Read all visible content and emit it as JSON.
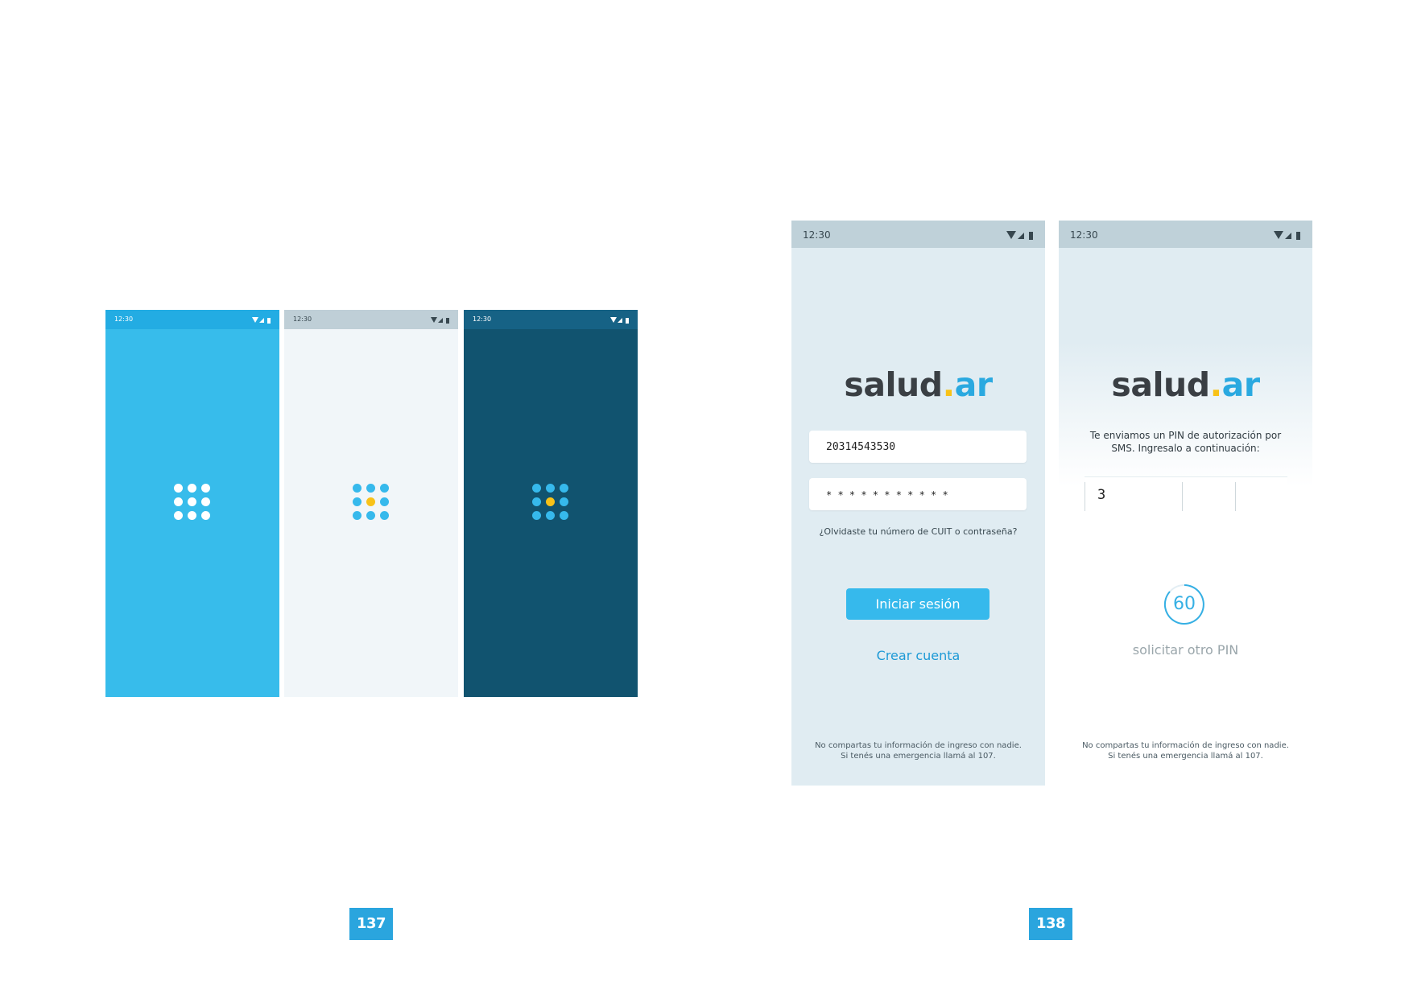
{
  "status_bar": {
    "time": "12:30"
  },
  "splash_screens": [
    {
      "theme": "light-blue",
      "bg": "#37bceb",
      "bar": "#23ace3",
      "dot": "#ffffff",
      "center_dot": "#ffffff"
    },
    {
      "theme": "white",
      "bg": "#f1f6f9",
      "bar": "#bfcfd7",
      "dot": "#36b9ec",
      "center_dot": "#f8c218"
    },
    {
      "theme": "dark-blue",
      "bg": "#11536f",
      "bar": "#166285",
      "dot": "#36b9ec",
      "center_dot": "#f8c218"
    }
  ],
  "logo": {
    "part1": "salud",
    "dot": ".",
    "part2": "ar"
  },
  "login": {
    "cuit_value": "20314543530",
    "password_value": "* * * * * * * * * * *",
    "forgot_link": "¿Olvidaste tu número de CUIT o contraseña?",
    "login_button": "Iniciar sesión",
    "create_account_link": "Crear cuenta",
    "footer_line1": "No compartas tu información de ingreso con nadie.",
    "footer_line2": "Si tenés una emergencia llamá al 107."
  },
  "pin": {
    "message_line1": "Te enviamos un PIN de autorización por",
    "message_line2": "SMS. Ingresalo a continuación:",
    "pin_value": "3",
    "countdown": "60",
    "resend_link": "solicitar otro PIN",
    "footer_line1": "No compartas tu información de ingreso con nadie.",
    "footer_line2": "Si tenés una emergencia llamá al 107."
  },
  "page_numbers": {
    "left": "137",
    "right": "138"
  },
  "colors": {
    "accent": "#36b9ec",
    "yellow": "#f8c218",
    "page_badge": "#2aa5de"
  }
}
